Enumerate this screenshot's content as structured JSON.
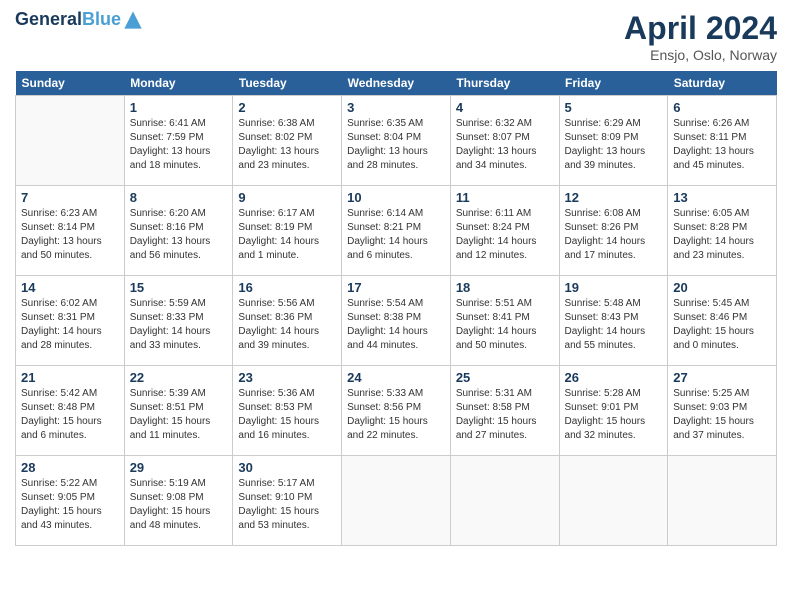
{
  "header": {
    "logo_line1": "General",
    "logo_line2": "Blue",
    "month": "April 2024",
    "location": "Ensjo, Oslo, Norway"
  },
  "weekdays": [
    "Sunday",
    "Monday",
    "Tuesday",
    "Wednesday",
    "Thursday",
    "Friday",
    "Saturday"
  ],
  "weeks": [
    [
      {
        "day": "",
        "sunrise": "",
        "sunset": "",
        "daylight": ""
      },
      {
        "day": "1",
        "sunrise": "6:41 AM",
        "sunset": "7:59 PM",
        "daylight": "13 hours and 18 minutes."
      },
      {
        "day": "2",
        "sunrise": "6:38 AM",
        "sunset": "8:02 PM",
        "daylight": "13 hours and 23 minutes."
      },
      {
        "day": "3",
        "sunrise": "6:35 AM",
        "sunset": "8:04 PM",
        "daylight": "13 hours and 28 minutes."
      },
      {
        "day": "4",
        "sunrise": "6:32 AM",
        "sunset": "8:07 PM",
        "daylight": "13 hours and 34 minutes."
      },
      {
        "day": "5",
        "sunrise": "6:29 AM",
        "sunset": "8:09 PM",
        "daylight": "13 hours and 39 minutes."
      },
      {
        "day": "6",
        "sunrise": "6:26 AM",
        "sunset": "8:11 PM",
        "daylight": "13 hours and 45 minutes."
      }
    ],
    [
      {
        "day": "7",
        "sunrise": "6:23 AM",
        "sunset": "8:14 PM",
        "daylight": "13 hours and 50 minutes."
      },
      {
        "day": "8",
        "sunrise": "6:20 AM",
        "sunset": "8:16 PM",
        "daylight": "13 hours and 56 minutes."
      },
      {
        "day": "9",
        "sunrise": "6:17 AM",
        "sunset": "8:19 PM",
        "daylight": "14 hours and 1 minute."
      },
      {
        "day": "10",
        "sunrise": "6:14 AM",
        "sunset": "8:21 PM",
        "daylight": "14 hours and 6 minutes."
      },
      {
        "day": "11",
        "sunrise": "6:11 AM",
        "sunset": "8:24 PM",
        "daylight": "14 hours and 12 minutes."
      },
      {
        "day": "12",
        "sunrise": "6:08 AM",
        "sunset": "8:26 PM",
        "daylight": "14 hours and 17 minutes."
      },
      {
        "day": "13",
        "sunrise": "6:05 AM",
        "sunset": "8:28 PM",
        "daylight": "14 hours and 23 minutes."
      }
    ],
    [
      {
        "day": "14",
        "sunrise": "6:02 AM",
        "sunset": "8:31 PM",
        "daylight": "14 hours and 28 minutes."
      },
      {
        "day": "15",
        "sunrise": "5:59 AM",
        "sunset": "8:33 PM",
        "daylight": "14 hours and 33 minutes."
      },
      {
        "day": "16",
        "sunrise": "5:56 AM",
        "sunset": "8:36 PM",
        "daylight": "14 hours and 39 minutes."
      },
      {
        "day": "17",
        "sunrise": "5:54 AM",
        "sunset": "8:38 PM",
        "daylight": "14 hours and 44 minutes."
      },
      {
        "day": "18",
        "sunrise": "5:51 AM",
        "sunset": "8:41 PM",
        "daylight": "14 hours and 50 minutes."
      },
      {
        "day": "19",
        "sunrise": "5:48 AM",
        "sunset": "8:43 PM",
        "daylight": "14 hours and 55 minutes."
      },
      {
        "day": "20",
        "sunrise": "5:45 AM",
        "sunset": "8:46 PM",
        "daylight": "15 hours and 0 minutes."
      }
    ],
    [
      {
        "day": "21",
        "sunrise": "5:42 AM",
        "sunset": "8:48 PM",
        "daylight": "15 hours and 6 minutes."
      },
      {
        "day": "22",
        "sunrise": "5:39 AM",
        "sunset": "8:51 PM",
        "daylight": "15 hours and 11 minutes."
      },
      {
        "day": "23",
        "sunrise": "5:36 AM",
        "sunset": "8:53 PM",
        "daylight": "15 hours and 16 minutes."
      },
      {
        "day": "24",
        "sunrise": "5:33 AM",
        "sunset": "8:56 PM",
        "daylight": "15 hours and 22 minutes."
      },
      {
        "day": "25",
        "sunrise": "5:31 AM",
        "sunset": "8:58 PM",
        "daylight": "15 hours and 27 minutes."
      },
      {
        "day": "26",
        "sunrise": "5:28 AM",
        "sunset": "9:01 PM",
        "daylight": "15 hours and 32 minutes."
      },
      {
        "day": "27",
        "sunrise": "5:25 AM",
        "sunset": "9:03 PM",
        "daylight": "15 hours and 37 minutes."
      }
    ],
    [
      {
        "day": "28",
        "sunrise": "5:22 AM",
        "sunset": "9:05 PM",
        "daylight": "15 hours and 43 minutes."
      },
      {
        "day": "29",
        "sunrise": "5:19 AM",
        "sunset": "9:08 PM",
        "daylight": "15 hours and 48 minutes."
      },
      {
        "day": "30",
        "sunrise": "5:17 AM",
        "sunset": "9:10 PM",
        "daylight": "15 hours and 53 minutes."
      },
      {
        "day": "",
        "sunrise": "",
        "sunset": "",
        "daylight": ""
      },
      {
        "day": "",
        "sunrise": "",
        "sunset": "",
        "daylight": ""
      },
      {
        "day": "",
        "sunrise": "",
        "sunset": "",
        "daylight": ""
      },
      {
        "day": "",
        "sunrise": "",
        "sunset": "",
        "daylight": ""
      }
    ]
  ]
}
